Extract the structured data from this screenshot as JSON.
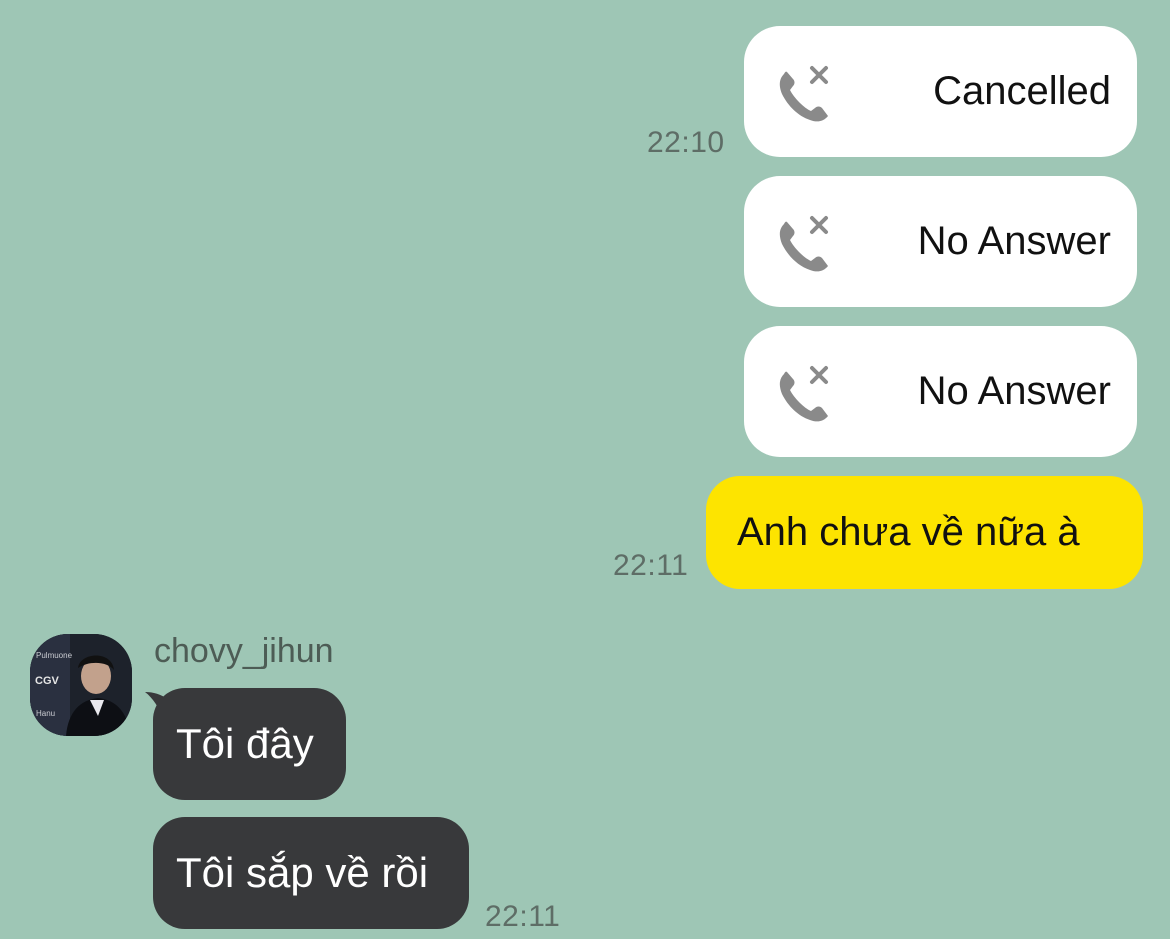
{
  "colors": {
    "background": "#9ec6b5",
    "outgoing_bubble": "#fde400",
    "incoming_bubble": "#38393b",
    "call_bubble": "#ffffff",
    "call_icon": "#8a8a8a"
  },
  "messages": {
    "calls": [
      {
        "icon": "missed-call-icon",
        "label": "Cancelled"
      },
      {
        "icon": "missed-call-icon",
        "label": "No Answer"
      },
      {
        "icon": "missed-call-icon",
        "label": "No Answer"
      }
    ],
    "calls_time": "22:10",
    "outgoing_text": "Anh chưa về nữa à",
    "outgoing_time": "22:11",
    "incoming": {
      "sender": "chovy_jihun",
      "avatar_icon": "user-avatar",
      "bubbles": [
        "Tôi đây",
        "Tôi sắp về rồi"
      ],
      "time": "22:11",
      "avatar_text": [
        "Pulmuone",
        "CGV",
        "Hanu"
      ]
    }
  }
}
